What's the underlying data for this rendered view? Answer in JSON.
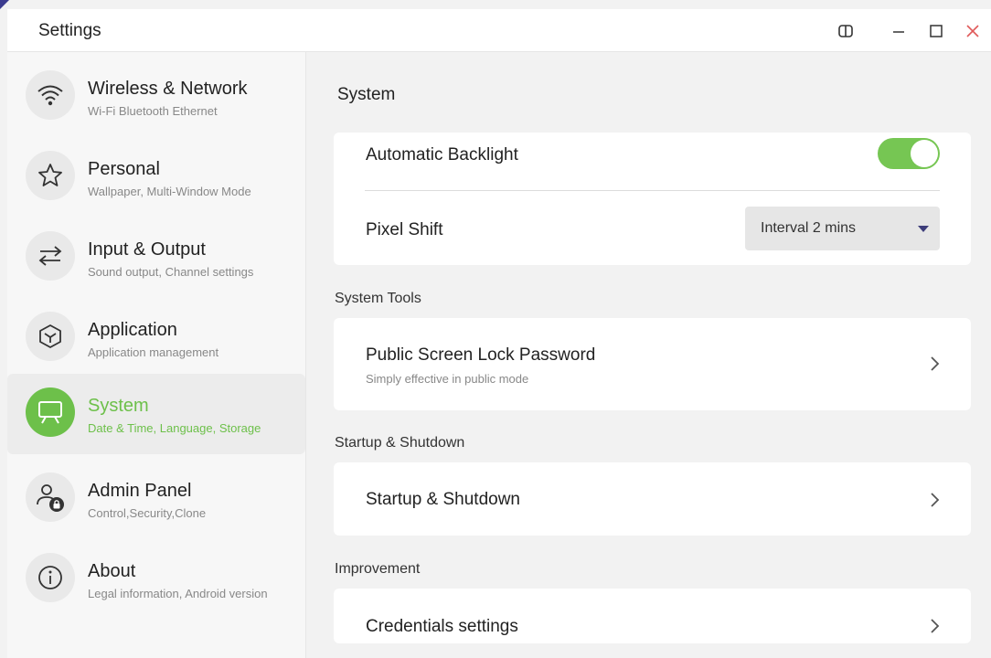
{
  "window": {
    "title": "Settings"
  },
  "sidebar": {
    "items": [
      {
        "title": "Wireless & Network",
        "subtitle": "Wi-Fi Bluetooth Ethernet",
        "icon": "wifi-icon"
      },
      {
        "title": "Personal",
        "subtitle": "Wallpaper, Multi-Window Mode",
        "icon": "star-icon"
      },
      {
        "title": "Input & Output",
        "subtitle": "Sound output, Channel settings",
        "icon": "swap-arrows-icon"
      },
      {
        "title": "Application",
        "subtitle": "Application management",
        "icon": "cube-icon"
      },
      {
        "title": "System",
        "subtitle": "Date & Time, Language, Storage",
        "icon": "monitor-icon",
        "active": true
      },
      {
        "title": "Admin Panel",
        "subtitle": "Control,Security,Clone",
        "icon": "user-lock-icon"
      },
      {
        "title": "About",
        "subtitle": "Legal information, Android version",
        "icon": "info-icon"
      }
    ]
  },
  "main": {
    "title": "System",
    "display": {
      "auto_backlight_label": "Automatic Backlight",
      "auto_backlight_on": true,
      "pixel_shift_label": "Pixel Shift",
      "pixel_shift_value": "Interval 2 mins"
    },
    "system_tools": {
      "header": "System Tools",
      "lock_label": "Public Screen Lock Password",
      "lock_sub": "Simply effective in public mode"
    },
    "startup": {
      "header": "Startup & Shutdown",
      "label": "Startup & Shutdown"
    },
    "improvement": {
      "header": "Improvement",
      "credentials_label": "Credentials settings"
    }
  },
  "colors": {
    "accent": "#6dc04a",
    "toggle_on": "#76c653",
    "close": "#e05a5a"
  }
}
